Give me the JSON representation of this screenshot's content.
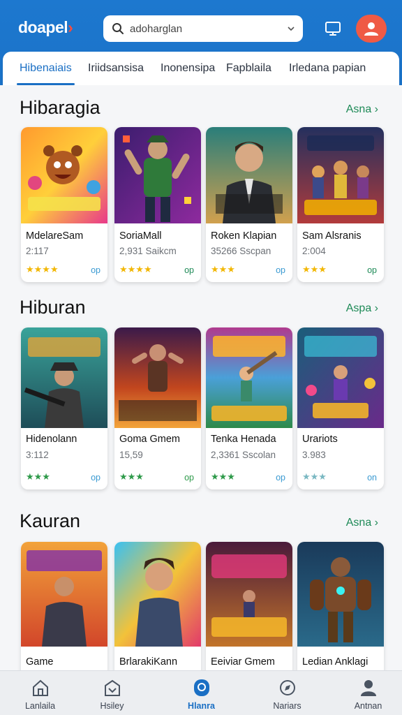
{
  "app": {
    "logo_text": "doapel",
    "logo_mark": "›",
    "search": {
      "value": "adoharglan",
      "icon": "search-icon"
    }
  },
  "tabs": [
    {
      "label": "Hibenaiais",
      "active": true
    },
    {
      "label": "Iriidsansisa",
      "active": false
    },
    {
      "label": "Inonensipa",
      "active": false
    },
    {
      "label": "Fapblaila",
      "active": false
    },
    {
      "label": "Irledana papian",
      "active": false
    }
  ],
  "sections": [
    {
      "title": "Hibaragia",
      "see_all": "Asna ›",
      "cards": [
        {
          "name": "MdelareSam",
          "meta": "2:117",
          "rating": 4,
          "stars": "★★★★",
          "price": "op",
          "art_text": "DXESN DIEL"
        },
        {
          "name": "SoriaMall",
          "meta": "2,931 Saikcm",
          "rating": 3.5,
          "stars": "★★★★",
          "price": "op",
          "art_text": ""
        },
        {
          "name": "Roken Klapian",
          "meta": "35266 Sscpan",
          "rating": 3,
          "stars": "★★★",
          "price": "op",
          "art_text": "IEALIRI D.SHAUIIN"
        },
        {
          "name": "Sam Alsranis",
          "meta": "2:004",
          "rating": 3,
          "stars": "★★★",
          "price": "op",
          "art_text": "GARIAK UAME SOLDARS"
        }
      ]
    },
    {
      "title": "Hiburan",
      "see_all": "Aspa ›",
      "cards": [
        {
          "name": "Hidenolann",
          "meta": "3:112",
          "rating": 3,
          "stars": "★★★",
          "price": "op",
          "art_text": "Krankva CHPUNSICRY"
        },
        {
          "name": "Goma Gmem",
          "meta": "15,59",
          "rating": 3,
          "stars": "★★★",
          "price": "op",
          "art_text": "HIRARAN CMP AOCSSON"
        },
        {
          "name": "Tenka Henada",
          "meta": "2,3361 Sscolan",
          "rating": 2.5,
          "stars": "★★★",
          "price": "op",
          "art_text": "PIEASAN BRUTAIADAR"
        },
        {
          "name": "Urariots",
          "meta": "3.983",
          "rating": 3,
          "stars": "★★★",
          "price": "on",
          "art_text": "SOANSY DDASTIES GASN"
        }
      ]
    },
    {
      "title": "Kauran",
      "see_all": "Asna ›",
      "cards": [
        {
          "name": "Game",
          "meta": "",
          "rating": 0,
          "stars": "",
          "price": "",
          "art_text": "TIPURVAS"
        },
        {
          "name": "BrlarakiKann",
          "meta": "",
          "rating": 0,
          "stars": "",
          "price": "",
          "art_text": ""
        },
        {
          "name": "Eeiviar Gmem",
          "meta": "",
          "rating": 0,
          "stars": "",
          "price": "",
          "art_text": "Caunala DIMBE! SHIDANS"
        },
        {
          "name": "Ledian Anklagi",
          "meta": "",
          "rating": 0,
          "stars": "",
          "price": "",
          "art_text": ""
        }
      ]
    }
  ],
  "bottom_nav": [
    {
      "label": "Lanlaila",
      "icon": "home-icon",
      "active": false
    },
    {
      "label": "Hsiley",
      "icon": "library-icon",
      "active": false
    },
    {
      "label": "Hlanra",
      "icon": "games-icon",
      "active": true
    },
    {
      "label": "Nariars",
      "icon": "compass-icon",
      "active": false
    },
    {
      "label": "Antnan",
      "icon": "profile-icon",
      "active": false
    }
  ],
  "colors": {
    "brand_blue": "#1a6fc4",
    "accent_red": "#ef5a45",
    "see_all_green": "#1e8a57",
    "star_gold": "#f2b705",
    "star_green": "#2e9a4a",
    "star_teal": "#7ab8c2"
  }
}
